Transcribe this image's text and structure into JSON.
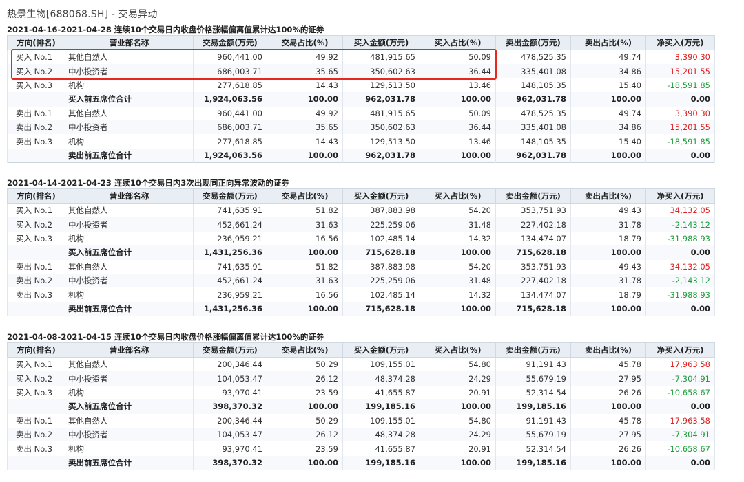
{
  "page_title": "热景生物[688068.SH] - 交易异动",
  "headers": [
    "方向(排名)",
    "营业部名称",
    "交易金额(万元)",
    "交易占比(%)",
    "买入金额(万元)",
    "买入占比(%)",
    "卖出金额(万元)",
    "卖出占比(%)",
    "净买入(万元)"
  ],
  "sections": [
    {
      "title": "2021-04-16-2021-04-28 连续10个交易日内收盘价格涨幅偏离值累计达100%的证券",
      "rows": [
        {
          "dir": "买入 No.1",
          "dept": "其他自然人",
          "amt": "960,441.00",
          "amt_pct": "49.92",
          "buy": "481,915.65",
          "buy_pct": "50.09",
          "sell": "478,525.35",
          "sell_pct": "49.74",
          "net": "3,390.30",
          "sign": "pos"
        },
        {
          "dir": "买入 No.2",
          "dept": "中小投资者",
          "amt": "686,003.71",
          "amt_pct": "35.65",
          "buy": "350,602.63",
          "buy_pct": "36.44",
          "sell": "335,401.08",
          "sell_pct": "34.86",
          "net": "15,201.55",
          "sign": "pos"
        },
        {
          "dir": "买入 No.3",
          "dept": "机构",
          "amt": "277,618.85",
          "amt_pct": "14.43",
          "buy": "129,513.50",
          "buy_pct": "13.46",
          "sell": "148,105.35",
          "sell_pct": "15.40",
          "net": "-18,591.85",
          "sign": "neg"
        },
        {
          "dir": "",
          "dept": "买入前五席位合计",
          "amt": "1,924,063.56",
          "amt_pct": "100.00",
          "buy": "962,031.78",
          "buy_pct": "100.00",
          "sell": "962,031.78",
          "sell_pct": "100.00",
          "net": "0.00",
          "sign": "zero",
          "sum": true
        },
        {
          "dir": "卖出 No.1",
          "dept": "其他自然人",
          "amt": "960,441.00",
          "amt_pct": "49.92",
          "buy": "481,915.65",
          "buy_pct": "50.09",
          "sell": "478,525.35",
          "sell_pct": "49.74",
          "net": "3,390.30",
          "sign": "pos"
        },
        {
          "dir": "卖出 No.2",
          "dept": "中小投资者",
          "amt": "686,003.71",
          "amt_pct": "35.65",
          "buy": "350,602.63",
          "buy_pct": "36.44",
          "sell": "335,401.08",
          "sell_pct": "34.86",
          "net": "15,201.55",
          "sign": "pos"
        },
        {
          "dir": "卖出 No.3",
          "dept": "机构",
          "amt": "277,618.85",
          "amt_pct": "14.43",
          "buy": "129,513.50",
          "buy_pct": "13.46",
          "sell": "148,105.35",
          "sell_pct": "15.40",
          "net": "-18,591.85",
          "sign": "neg"
        },
        {
          "dir": "",
          "dept": "卖出前五席位合计",
          "amt": "1,924,063.56",
          "amt_pct": "100.00",
          "buy": "962,031.78",
          "buy_pct": "100.00",
          "sell": "962,031.78",
          "sell_pct": "100.00",
          "net": "0.00",
          "sign": "zero",
          "sum": true
        }
      ]
    },
    {
      "title": "2021-04-14-2021-04-23 连续10个交易日内3次出现同正向异常波动的证券",
      "rows": [
        {
          "dir": "买入 No.1",
          "dept": "其他自然人",
          "amt": "741,635.91",
          "amt_pct": "51.82",
          "buy": "387,883.98",
          "buy_pct": "54.20",
          "sell": "353,751.93",
          "sell_pct": "49.43",
          "net": "34,132.05",
          "sign": "pos"
        },
        {
          "dir": "买入 No.2",
          "dept": "中小投资者",
          "amt": "452,661.24",
          "amt_pct": "31.63",
          "buy": "225,259.06",
          "buy_pct": "31.48",
          "sell": "227,402.18",
          "sell_pct": "31.78",
          "net": "-2,143.12",
          "sign": "neg"
        },
        {
          "dir": "买入 No.3",
          "dept": "机构",
          "amt": "236,959.21",
          "amt_pct": "16.56",
          "buy": "102,485.14",
          "buy_pct": "14.32",
          "sell": "134,474.07",
          "sell_pct": "18.79",
          "net": "-31,988.93",
          "sign": "neg"
        },
        {
          "dir": "",
          "dept": "买入前五席位合计",
          "amt": "1,431,256.36",
          "amt_pct": "100.00",
          "buy": "715,628.18",
          "buy_pct": "100.00",
          "sell": "715,628.18",
          "sell_pct": "100.00",
          "net": "0.00",
          "sign": "zero",
          "sum": true
        },
        {
          "dir": "卖出 No.1",
          "dept": "其他自然人",
          "amt": "741,635.91",
          "amt_pct": "51.82",
          "buy": "387,883.98",
          "buy_pct": "54.20",
          "sell": "353,751.93",
          "sell_pct": "49.43",
          "net": "34,132.05",
          "sign": "pos"
        },
        {
          "dir": "卖出 No.2",
          "dept": "中小投资者",
          "amt": "452,661.24",
          "amt_pct": "31.63",
          "buy": "225,259.06",
          "buy_pct": "31.48",
          "sell": "227,402.18",
          "sell_pct": "31.78",
          "net": "-2,143.12",
          "sign": "neg"
        },
        {
          "dir": "卖出 No.3",
          "dept": "机构",
          "amt": "236,959.21",
          "amt_pct": "16.56",
          "buy": "102,485.14",
          "buy_pct": "14.32",
          "sell": "134,474.07",
          "sell_pct": "18.79",
          "net": "-31,988.93",
          "sign": "neg"
        },
        {
          "dir": "",
          "dept": "卖出前五席位合计",
          "amt": "1,431,256.36",
          "amt_pct": "100.00",
          "buy": "715,628.18",
          "buy_pct": "100.00",
          "sell": "715,628.18",
          "sell_pct": "100.00",
          "net": "0.00",
          "sign": "zero",
          "sum": true
        }
      ]
    },
    {
      "title": "2021-04-08-2021-04-15 连续10个交易日内收盘价格涨幅偏离值累计达100%的证券",
      "rows": [
        {
          "dir": "买入 No.1",
          "dept": "其他自然人",
          "amt": "200,346.44",
          "amt_pct": "50.29",
          "buy": "109,155.01",
          "buy_pct": "54.80",
          "sell": "91,191.43",
          "sell_pct": "45.78",
          "net": "17,963.58",
          "sign": "pos"
        },
        {
          "dir": "买入 No.2",
          "dept": "中小投资者",
          "amt": "104,053.47",
          "amt_pct": "26.12",
          "buy": "48,374.28",
          "buy_pct": "24.29",
          "sell": "55,679.19",
          "sell_pct": "27.95",
          "net": "-7,304.91",
          "sign": "neg"
        },
        {
          "dir": "买入 No.3",
          "dept": "机构",
          "amt": "93,970.41",
          "amt_pct": "23.59",
          "buy": "41,655.87",
          "buy_pct": "20.91",
          "sell": "52,314.54",
          "sell_pct": "26.26",
          "net": "-10,658.67",
          "sign": "neg"
        },
        {
          "dir": "",
          "dept": "买入前五席位合计",
          "amt": "398,370.32",
          "amt_pct": "100.00",
          "buy": "199,185.16",
          "buy_pct": "100.00",
          "sell": "199,185.16",
          "sell_pct": "100.00",
          "net": "0.00",
          "sign": "zero",
          "sum": true
        },
        {
          "dir": "卖出 No.1",
          "dept": "其他自然人",
          "amt": "200,346.44",
          "amt_pct": "50.29",
          "buy": "109,155.01",
          "buy_pct": "54.80",
          "sell": "91,191.43",
          "sell_pct": "45.78",
          "net": "17,963.58",
          "sign": "pos"
        },
        {
          "dir": "卖出 No.2",
          "dept": "中小投资者",
          "amt": "104,053.47",
          "amt_pct": "26.12",
          "buy": "48,374.28",
          "buy_pct": "24.29",
          "sell": "55,679.19",
          "sell_pct": "27.95",
          "net": "-7,304.91",
          "sign": "neg"
        },
        {
          "dir": "卖出 No.3",
          "dept": "机构",
          "amt": "93,970.41",
          "amt_pct": "23.59",
          "buy": "41,655.87",
          "buy_pct": "20.91",
          "sell": "52,314.54",
          "sell_pct": "26.26",
          "net": "-10,658.67",
          "sign": "neg"
        },
        {
          "dir": "",
          "dept": "卖出前五席位合计",
          "amt": "398,370.32",
          "amt_pct": "100.00",
          "buy": "199,185.16",
          "buy_pct": "100.00",
          "sell": "199,185.16",
          "sell_pct": "100.00",
          "net": "0.00",
          "sign": "zero",
          "sum": true
        }
      ]
    }
  ]
}
